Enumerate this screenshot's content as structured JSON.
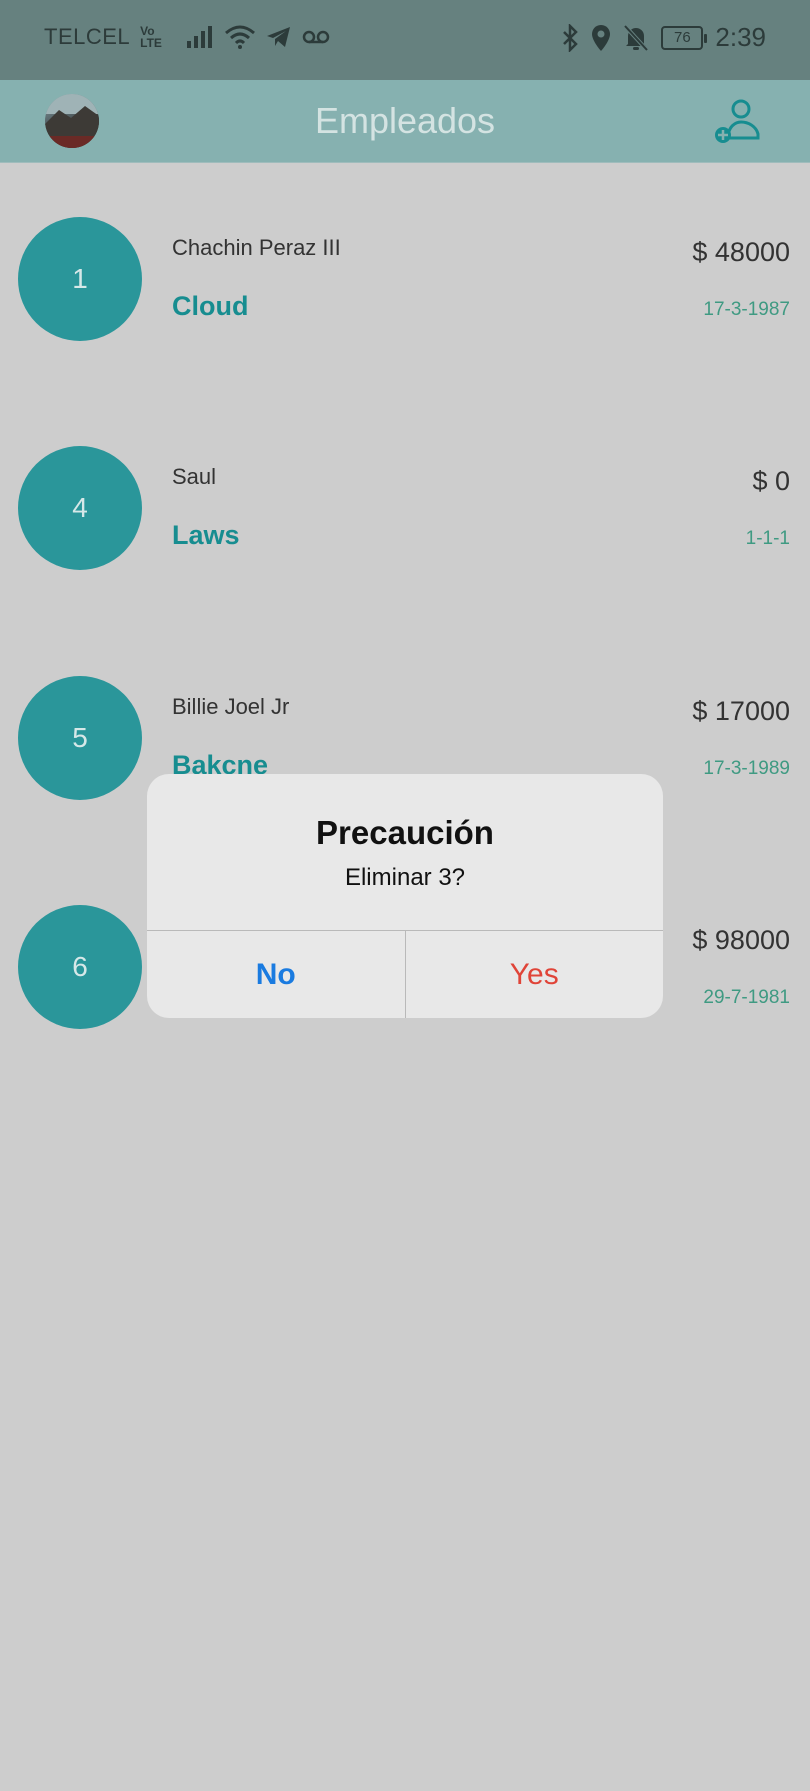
{
  "status_bar": {
    "carrier": "TELCEL",
    "volte_top": "Vo",
    "volte_bottom": "LTE",
    "battery": "76",
    "time": "2:39"
  },
  "app_bar": {
    "title": "Empleados"
  },
  "employees": [
    {
      "id": "1",
      "name": "Chachin Peraz III",
      "role": "Cloud",
      "salary": "$ 48000",
      "date": "17-3-1987"
    },
    {
      "id": "4",
      "name": "Saul",
      "role": "Laws",
      "salary": "$ 0",
      "date": "1-1-1"
    },
    {
      "id": "5",
      "name": "Billie Joel Jr",
      "role": "Bakcne",
      "salary": "$ 17000",
      "date": "17-3-1989"
    },
    {
      "id": "6",
      "name": "",
      "role": "",
      "salary": "$ 98000",
      "date": "29-7-1981"
    }
  ],
  "dialog": {
    "title": "Precaución",
    "message": "Eliminar 3?",
    "no_label": "No",
    "yes_label": "Yes"
  },
  "colors": {
    "status_bar": "#66817f",
    "app_bar": "#86b1b0",
    "accent": "#2a969a",
    "background": "#cdcdcd",
    "no_button": "#1a7be0",
    "yes_button": "#e04438"
  }
}
